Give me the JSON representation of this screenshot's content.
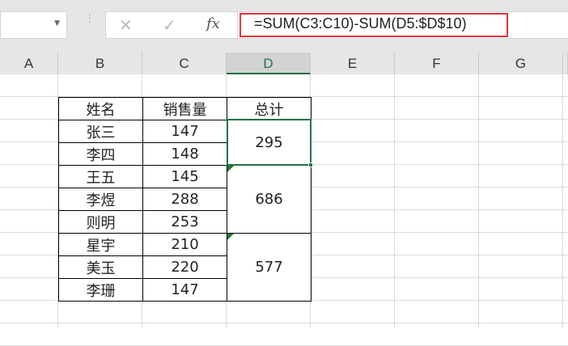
{
  "formula_bar": {
    "formula": "=SUM(C3:C10)-SUM(D5:$D$10)",
    "cancel_icon": "✕",
    "enter_icon": "✓",
    "fx_label": "fx"
  },
  "columns": [
    "A",
    "B",
    "C",
    "D",
    "E",
    "F",
    "G"
  ],
  "table": {
    "headers": [
      "姓名",
      "销售量",
      "总计"
    ],
    "rows": [
      [
        "张三",
        "147"
      ],
      [
        "李四",
        "148"
      ],
      [
        "王五",
        "145"
      ],
      [
        "李煜",
        "288"
      ],
      [
        "则明",
        "253"
      ],
      [
        "星宇",
        "210"
      ],
      [
        "美玉",
        "220"
      ],
      [
        "李珊",
        "147"
      ]
    ],
    "totals": [
      "295",
      "686",
      "577"
    ]
  },
  "accent": "#217346"
}
